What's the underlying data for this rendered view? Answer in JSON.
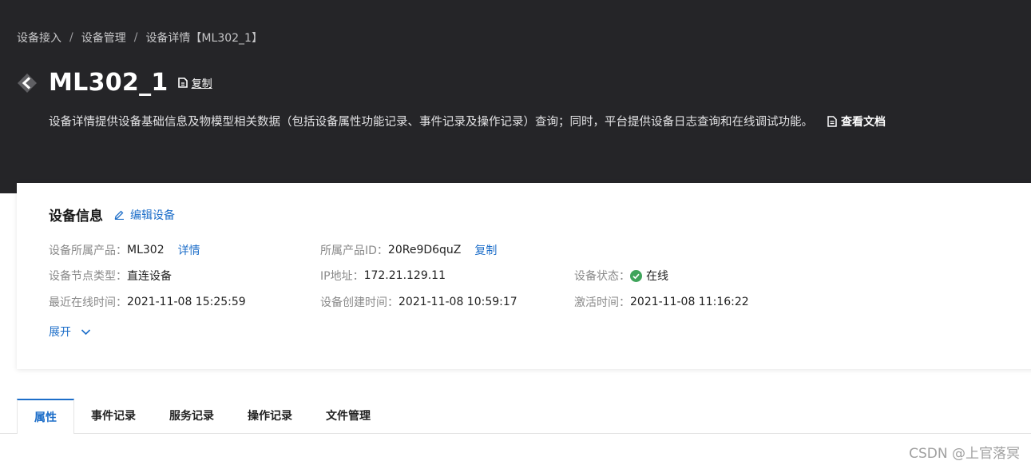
{
  "breadcrumb": {
    "items": [
      "设备接入",
      "设备管理",
      "设备详情【ML302_1】"
    ],
    "separator": "/"
  },
  "title": "ML302_1",
  "copy_label": "复制",
  "description": "设备详情提供设备基础信息及物模型相关数据（包括设备属性功能记录、事件记录及操作记录）查询；同时，平台提供设备日志查询和在线调试功能。",
  "doc_link": "查看文档",
  "device_info": {
    "title": "设备信息",
    "edit_label": "编辑设备",
    "product_label": "设备所属产品：",
    "product_value": "ML302",
    "product_link": "详情",
    "product_id_label": "所属产品ID：",
    "product_id_value": "20Re9D6quZ",
    "product_id_link": "复制",
    "node_type_label": "设备节点类型：",
    "node_type_value": "直连设备",
    "ip_label": "IP地址：",
    "ip_value": "172.21.129.11",
    "status_label": "设备状态：",
    "status_value": "在线",
    "last_online_label": "最近在线时间：",
    "last_online_value": "2021-11-08 15:25:59",
    "created_label": "设备创建时间：",
    "created_value": "2021-11-08 10:59:17",
    "activated_label": "激活时间：",
    "activated_value": "2021-11-08 11:16:22",
    "expand_label": "展开"
  },
  "tabs": [
    "属性",
    "事件记录",
    "服务记录",
    "操作记录",
    "文件管理"
  ],
  "watermark": "CSDN @上官落冥",
  "colors": {
    "header_bg": "#252528",
    "accent": "#1d6ec9",
    "status_online": "#3fa45b"
  },
  "icons": {
    "back": "back-arrow-icon",
    "copy": "copy-icon",
    "doc": "document-icon",
    "edit": "edit-pencil-icon",
    "status": "check-circle-icon",
    "expand": "chevron-down-icon"
  }
}
